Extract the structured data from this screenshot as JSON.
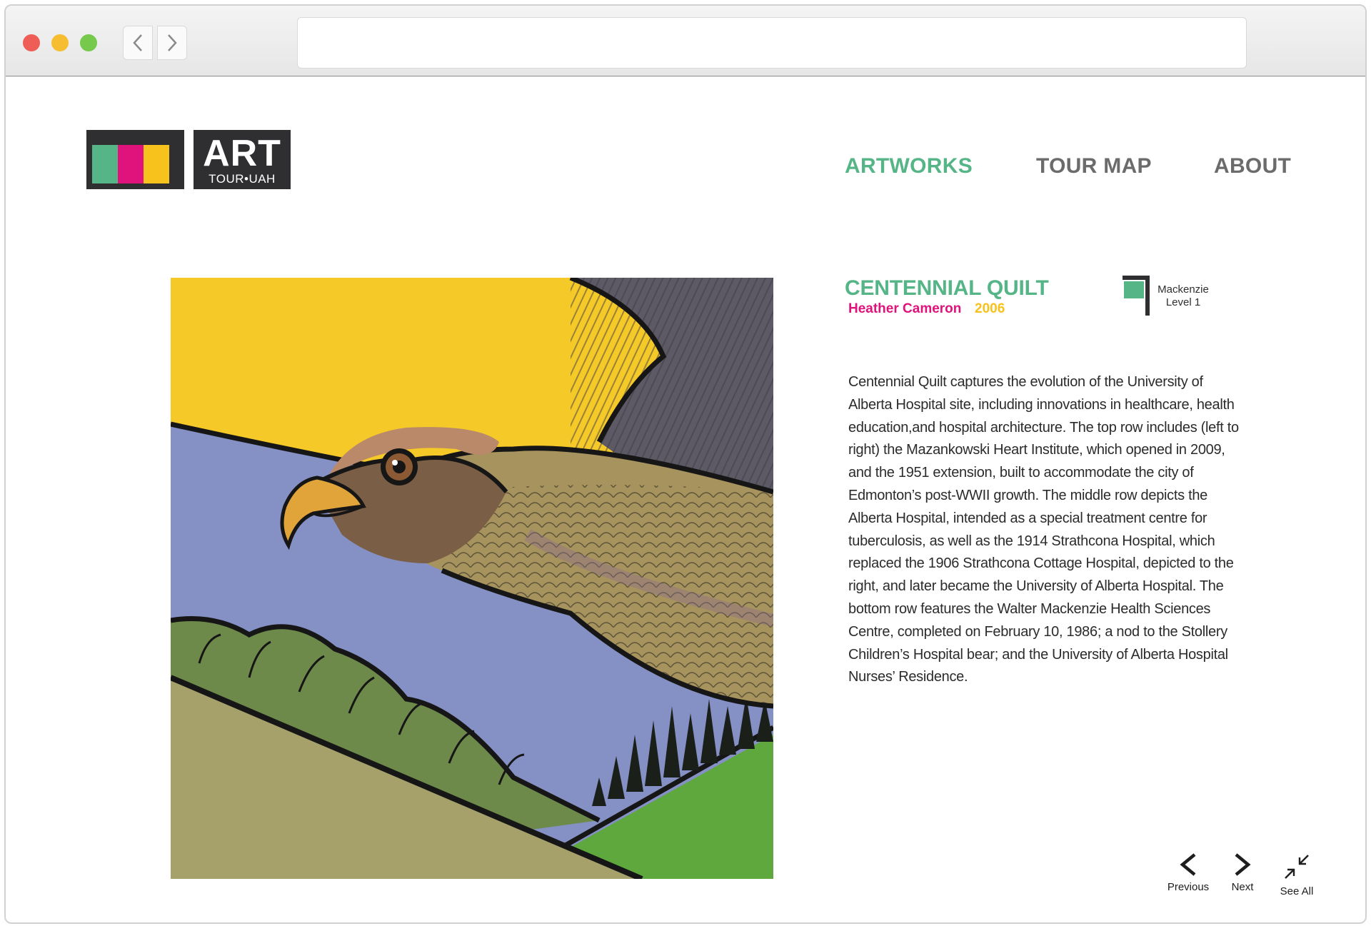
{
  "browser": {
    "back_icon": "chevron-left-icon",
    "forward_icon": "chevron-right-icon",
    "url": ""
  },
  "logo": {
    "art": "ART",
    "subtitle": "TOUR•UAH",
    "colors": [
      "#55b587",
      "#e0127c",
      "#f7c21b"
    ]
  },
  "nav": {
    "items": [
      {
        "label": "ARTWORKS",
        "active": true
      },
      {
        "label": "TOUR MAP",
        "active": false
      },
      {
        "label": "ABOUT",
        "active": false
      }
    ]
  },
  "artwork": {
    "title": "CENTENNIAL QUILT",
    "artist": "Heather Cameron",
    "year": "2006",
    "location_line1": "Mackenzie",
    "location_line2": "Level 1",
    "description": "Centennial Quilt captures the evolution of the University of Alberta Hospital site, including innovations in healthcare, health education,and hospital architecture. The top row includes (left to right) the Mazankowski Heart Institute, which opened in 2009, and the 1951 extension, built to accommodate the city of Edmonton’s post-WWII growth. The middle row depicts the Alberta Hospital, intended as a special treatment centre for tuberculosis, as well as the 1914 Strathcona Hospital, which replaced the 1906 Strathcona Cottage Hospital, depicted to the right, and later became the University of Alberta Hospital. The bottom row features the Walter Mackenzie Health Sciences Centre, completed on February 10, 1986; a nod to the Stollery Children’s Hospital bear; and the University of Alberta Hospital Nurses’ Residence."
  },
  "pager": {
    "previous": "Previous",
    "next": "Next",
    "see_all": "See All"
  },
  "colors": {
    "green": "#55b587",
    "magenta": "#e0127c",
    "yellow": "#f7c21b",
    "dark": "#2f2f31",
    "nav_gray": "#6b6b6b"
  }
}
